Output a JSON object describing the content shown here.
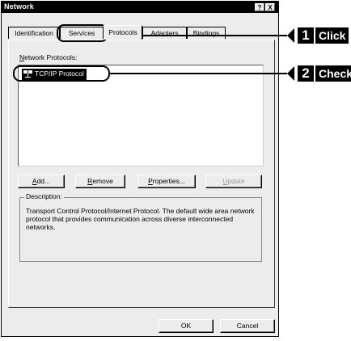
{
  "window": {
    "title": "Network",
    "help_label": "?",
    "close_label": "X"
  },
  "tabs": [
    "Identification",
    "Services",
    "Protocols",
    "Adapters",
    "Bindings"
  ],
  "protocols": {
    "list_label": "Network Protocols:",
    "items": [
      "TCP/IP Protocol"
    ]
  },
  "buttons": {
    "add": "Add...",
    "remove": "Remove",
    "properties": "Properties...",
    "update": "Update"
  },
  "description": {
    "label": "Description:",
    "text": "Transport Control Protocol/Internet Protocol. The default wide area network protocol that provides communication across diverse interconnected networks."
  },
  "footer": {
    "ok": "OK",
    "cancel": "Cancel"
  },
  "annotations": [
    {
      "number": "1",
      "text": "Click"
    },
    {
      "number": "2",
      "text": "Check"
    }
  ]
}
